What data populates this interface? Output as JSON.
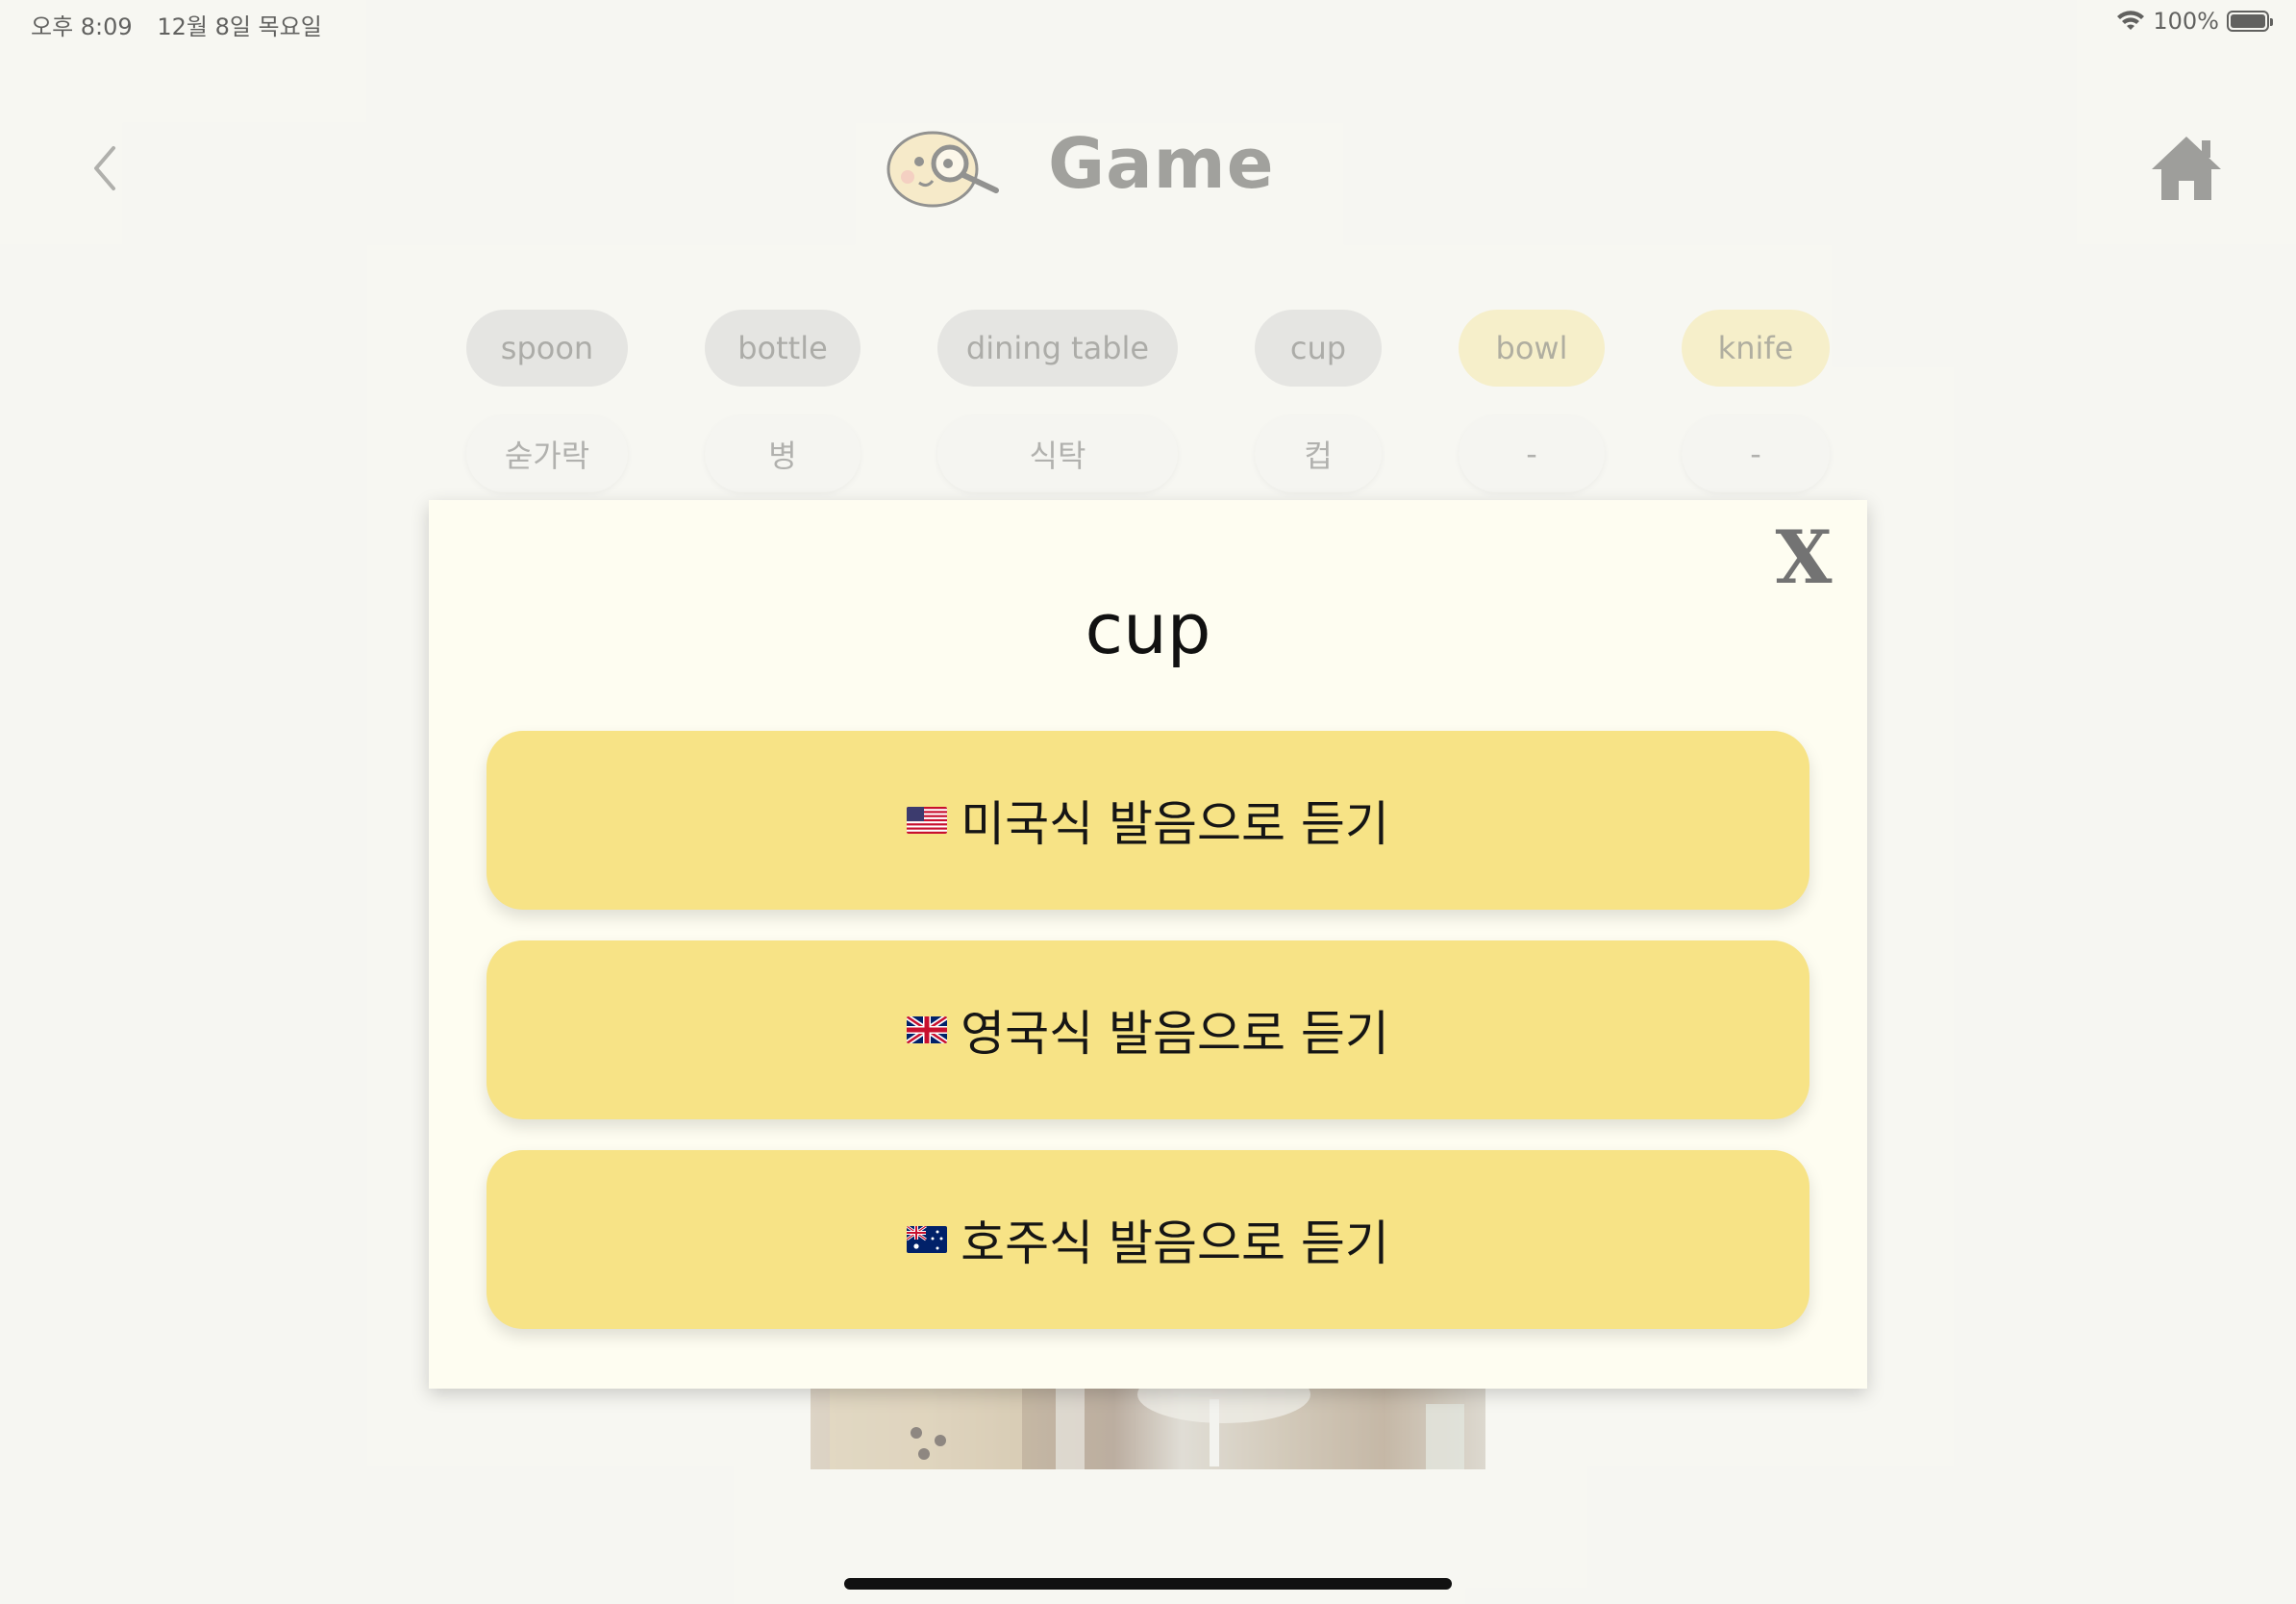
{
  "status_bar": {
    "time": "오후 8:09",
    "date": "12월 8일 목요일",
    "battery": "100%",
    "battery_level": 1.0
  },
  "header": {
    "title": "Game",
    "back_icon": "chevron-left-icon",
    "home_icon": "home-icon",
    "logo_icon": "magnifier-character-icon"
  },
  "words": [
    {
      "en": "spoon",
      "ko": "숟가락",
      "state": "grey"
    },
    {
      "en": "bottle",
      "ko": "병",
      "state": "grey"
    },
    {
      "en": "dining table",
      "ko": "식탁",
      "state": "grey"
    },
    {
      "en": "cup",
      "ko": "컵",
      "state": "grey"
    },
    {
      "en": "bowl",
      "ko": "-",
      "state": "yellow"
    },
    {
      "en": "knife",
      "ko": "-",
      "state": "yellow"
    }
  ],
  "modal": {
    "close_label": "X",
    "word": "cup",
    "buttons": [
      {
        "flag": "us-flag-icon",
        "label": "미국식 발음으로 듣기"
      },
      {
        "flag": "uk-flag-icon",
        "label": "영국식 발음으로 듣기"
      },
      {
        "flag": "au-flag-icon",
        "label": "호주식 발음으로 듣기"
      }
    ]
  },
  "colors": {
    "background": "#f7f7f3",
    "chip_grey": "#dcdcda",
    "chip_yellow": "#f6ebb6",
    "modal_bg": "#fefdf1",
    "button_yellow": "#f7e386",
    "title_grey": "#747470"
  }
}
